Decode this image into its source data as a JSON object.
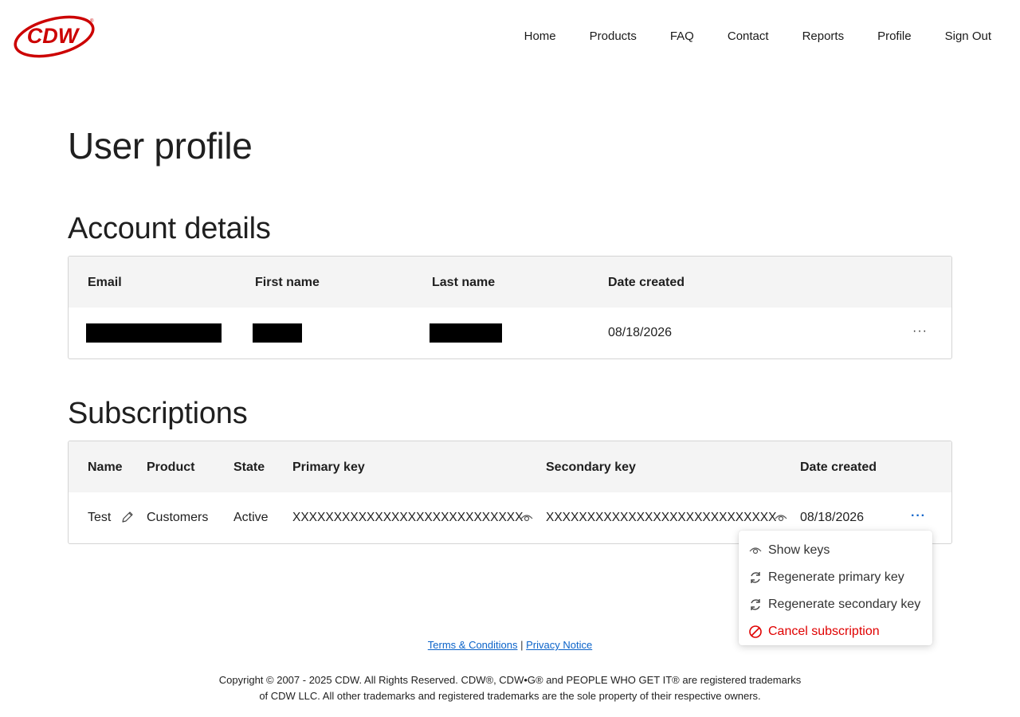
{
  "brand": {
    "logo_text": "CDW",
    "logo_color": "#cc0000"
  },
  "nav": {
    "items": [
      "Home",
      "Products",
      "FAQ",
      "Contact",
      "Reports",
      "Profile",
      "Sign Out"
    ]
  },
  "page": {
    "title": "User profile"
  },
  "account": {
    "title": "Account details",
    "headers": {
      "email": "Email",
      "first_name": "First name",
      "last_name": "Last name",
      "date_created": "Date created"
    },
    "row": {
      "date_created": "08/18/2026",
      "more": "···"
    }
  },
  "subscriptions": {
    "title": "Subscriptions",
    "headers": {
      "name": "Name",
      "product": "Product",
      "state": "State",
      "primary_key": "Primary key",
      "secondary_key": "Secondary key",
      "date_created": "Date created"
    },
    "row": {
      "name": "Test",
      "product": "Customers",
      "state": "Active",
      "primary_key": "XXXXXXXXXXXXXXXXXXXXXXXXXXXX",
      "secondary_key": "XXXXXXXXXXXXXXXXXXXXXXXXXXXX",
      "date_created": "08/18/2026",
      "more": "···"
    }
  },
  "menu": {
    "show_keys": "Show keys",
    "regen_primary": "Regenerate primary key",
    "regen_secondary": "Regenerate secondary key",
    "cancel": "Cancel subscription"
  },
  "footer": {
    "terms": "Terms & Conditions",
    "separator": "|",
    "privacy": "Privacy Notice",
    "copyright_line1": "Copyright © 2007 - 2025 CDW. All Rights Reserved. CDW®, CDW•G® and PEOPLE WHO GET IT® are registered trademarks",
    "copyright_line2": "of CDW LLC. All other trademarks and registered trademarks are the sole property of their respective owners."
  },
  "colors": {
    "accent": "#0b63c9",
    "danger": "#e00000",
    "header_bg": "#f4f4f4"
  }
}
